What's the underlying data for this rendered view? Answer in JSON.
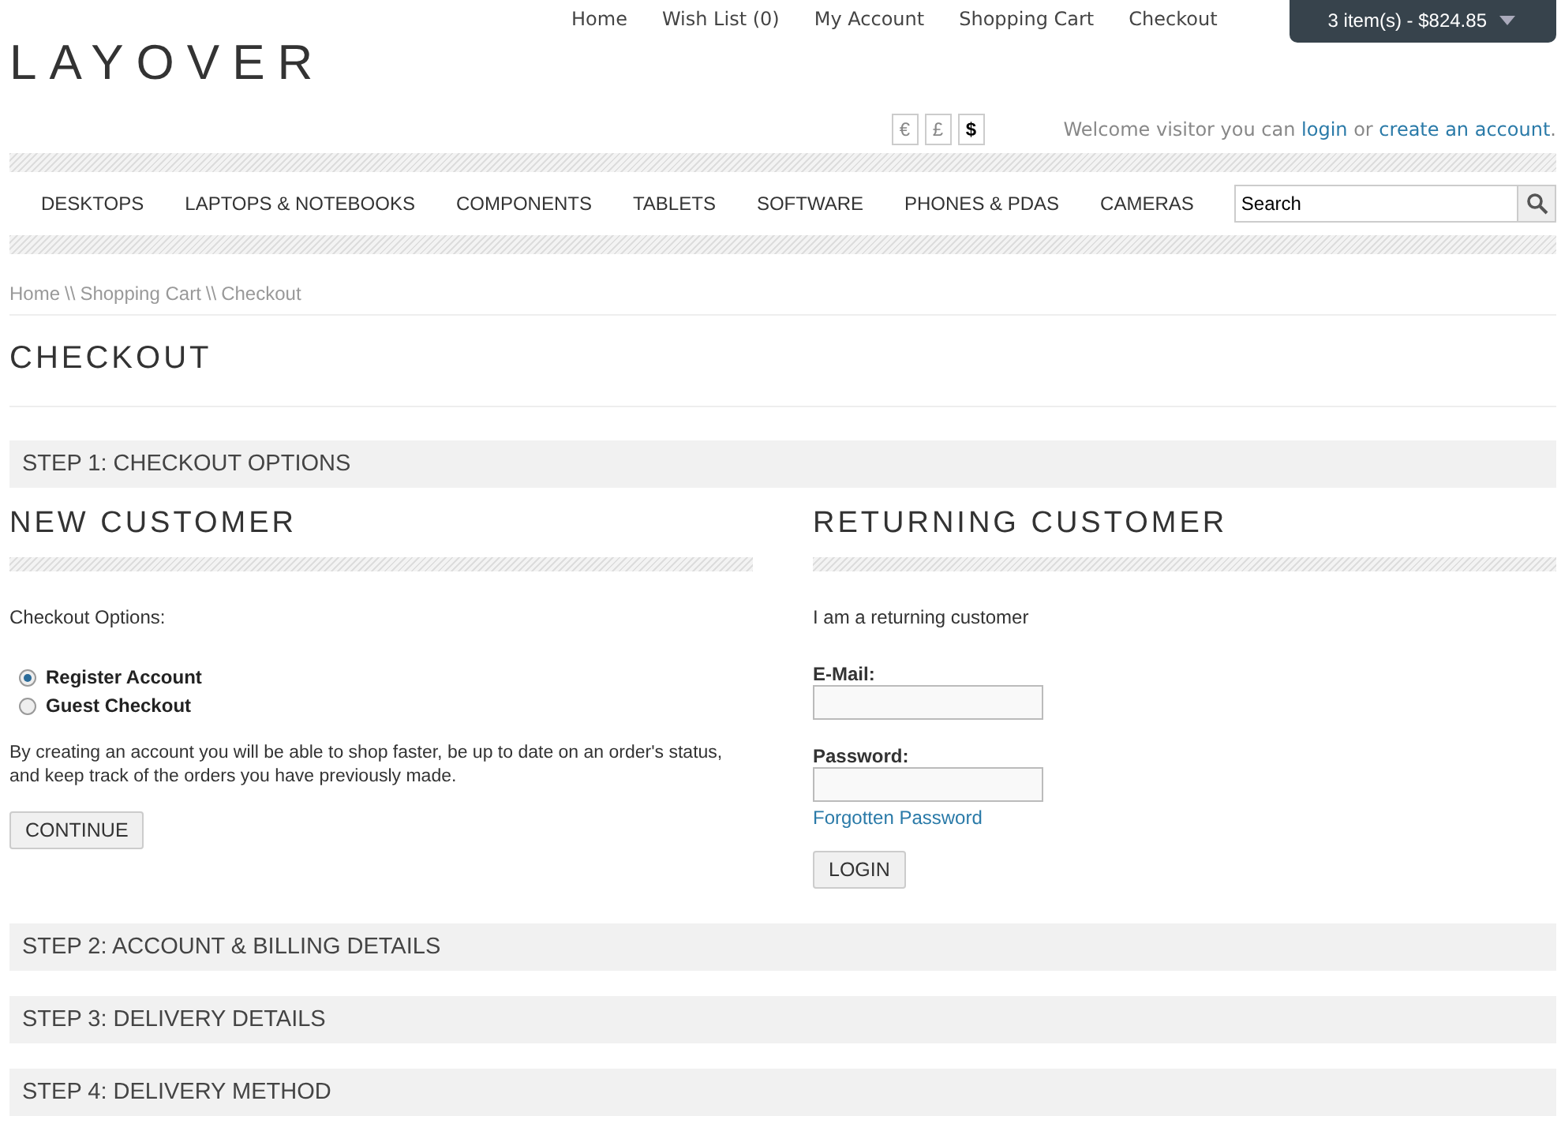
{
  "top_links": [
    "Home",
    "Wish List (0)",
    "My Account",
    "Shopping Cart",
    "Checkout"
  ],
  "cart_button": "3 item(s) - $824.85",
  "logo": "LAYOVER",
  "currencies": [
    {
      "symbol": "€",
      "selected": false
    },
    {
      "symbol": "£",
      "selected": false
    },
    {
      "symbol": "$",
      "selected": true
    }
  ],
  "welcome": {
    "before": "Welcome visitor you can",
    "login_link": "login",
    "middle": "or",
    "account_link": "create an account",
    "after": "."
  },
  "menu": [
    "DESKTOPS",
    "LAPTOPS & NOTEBOOKS",
    "COMPONENTS",
    "TABLETS",
    "SOFTWARE",
    "PHONES & PDAS",
    "CAMERAS"
  ],
  "search": {
    "value": "Search"
  },
  "breadcrumb": [
    "Home",
    "Shopping Cart",
    "Checkout"
  ],
  "breadcrumb_separator": "\\\\",
  "page_title": "CHECKOUT",
  "open_step": {
    "title": "STEP 1: CHECKOUT OPTIONS"
  },
  "closed_steps": [
    {
      "title": "STEP 2: ACCOUNT & BILLING DETAILS"
    },
    {
      "title": "STEP 3: DELIVERY DETAILS"
    },
    {
      "title": "STEP 4: DELIVERY METHOD"
    }
  ],
  "new_customer": {
    "heading": "NEW CUSTOMER",
    "options_label": "Checkout Options:",
    "options": [
      {
        "label": "Register Account",
        "selected": true
      },
      {
        "label": "Guest Checkout",
        "selected": false
      }
    ],
    "description": "By creating an account you will be able to shop faster, be up to date on an order's status, and keep track of the orders you have previously made.",
    "button": "CONTINUE"
  },
  "returning_customer": {
    "heading": "RETURNING CUSTOMER",
    "intro": "I am a returning customer",
    "email_label": "E-Mail:",
    "password_label": "Password:",
    "forgot_link": "Forgotten Password",
    "button": "LOGIN"
  }
}
